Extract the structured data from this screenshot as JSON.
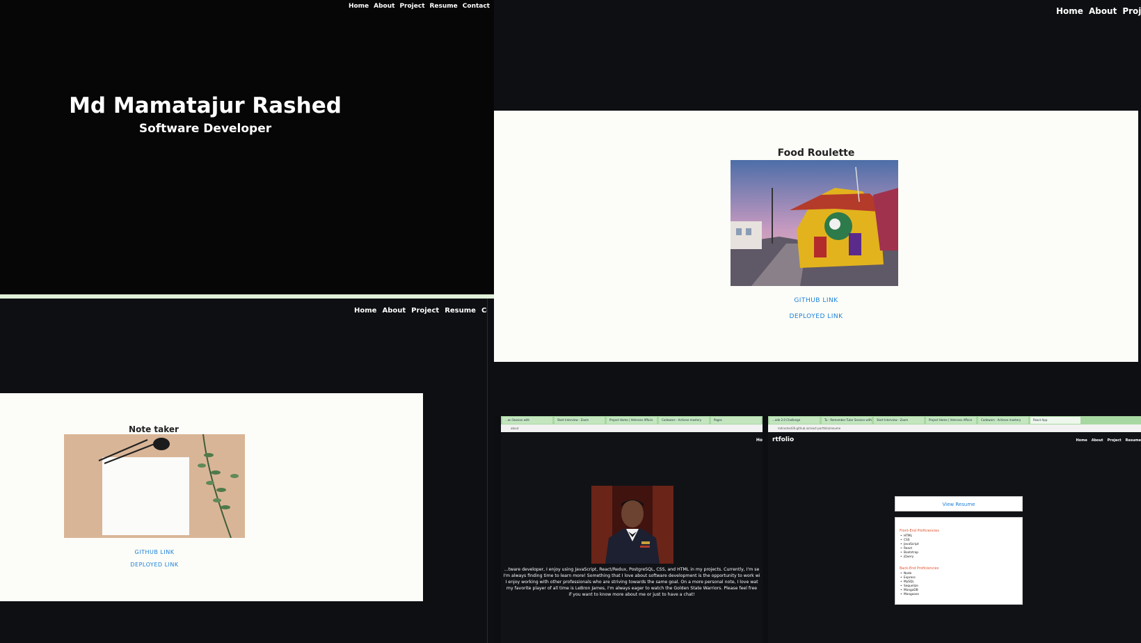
{
  "nav": {
    "home": "Home",
    "about": "About",
    "project": "Project",
    "resume": "Resume",
    "contact": "Contact"
  },
  "hero": {
    "name": "Md Mamatajur Rashed",
    "role": "Software Developer"
  },
  "projects": [
    {
      "title": "Food Roulette",
      "github": "GITHUB LINK",
      "deployed": "DEPLOYED LINK"
    },
    {
      "title": "Note taker",
      "github": "GITHUB LINK",
      "deployed": "DEPLOYED LINK"
    }
  ],
  "browser_about": {
    "tabs": [
      "...on Session with",
      "Start Interview - Zoom",
      "Project Home | Veterans Affairs",
      "Codewars - Achieve mastery",
      "Pages",
      "React App"
    ],
    "address": "about",
    "nav_fragment": "Ho",
    "bio_lines": [
      "...tware developer, I enjoy using JavaScript, React/Redux, PostgreSQL, CSS, and HTML in my projects. Currently, I'm se",
      "I'm always finding time to learn more! Something that I love about software development is the opportunity to work wi",
      "I enjoy working with other professionals who are striving towards the same goal. On a more personal note, I love wat",
      "my favorite player of all time is LeBron James, I'm always eager to watch the Golden State Warriors. Please feel free",
      "if you want to know more about me or just to have a chat!"
    ]
  },
  "browser_resume": {
    "tabs": [
      "...ode 2.0 Challenge",
      "Tu - Remember Tutor Session with",
      "Start Interview - Zoom",
      "Project Home | Veterans Affairs",
      "Codewars - Achieve mastery",
      "Pages",
      "React App"
    ],
    "address": "mdrashed30.github.io/react-portfolio/resume",
    "brand": "rtfolio",
    "view_resume": "View Resume",
    "front_title": "Front-End Proficiencies",
    "front": [
      "HTML",
      "CSS",
      "JavaScript",
      "React",
      "Bootstrap",
      "jQuery"
    ],
    "back_title": "Back-End Proficiencies",
    "back": [
      "Node",
      "Express",
      "MySQL",
      "Sequelize",
      "MongoDB",
      "Mongoose"
    ]
  }
}
